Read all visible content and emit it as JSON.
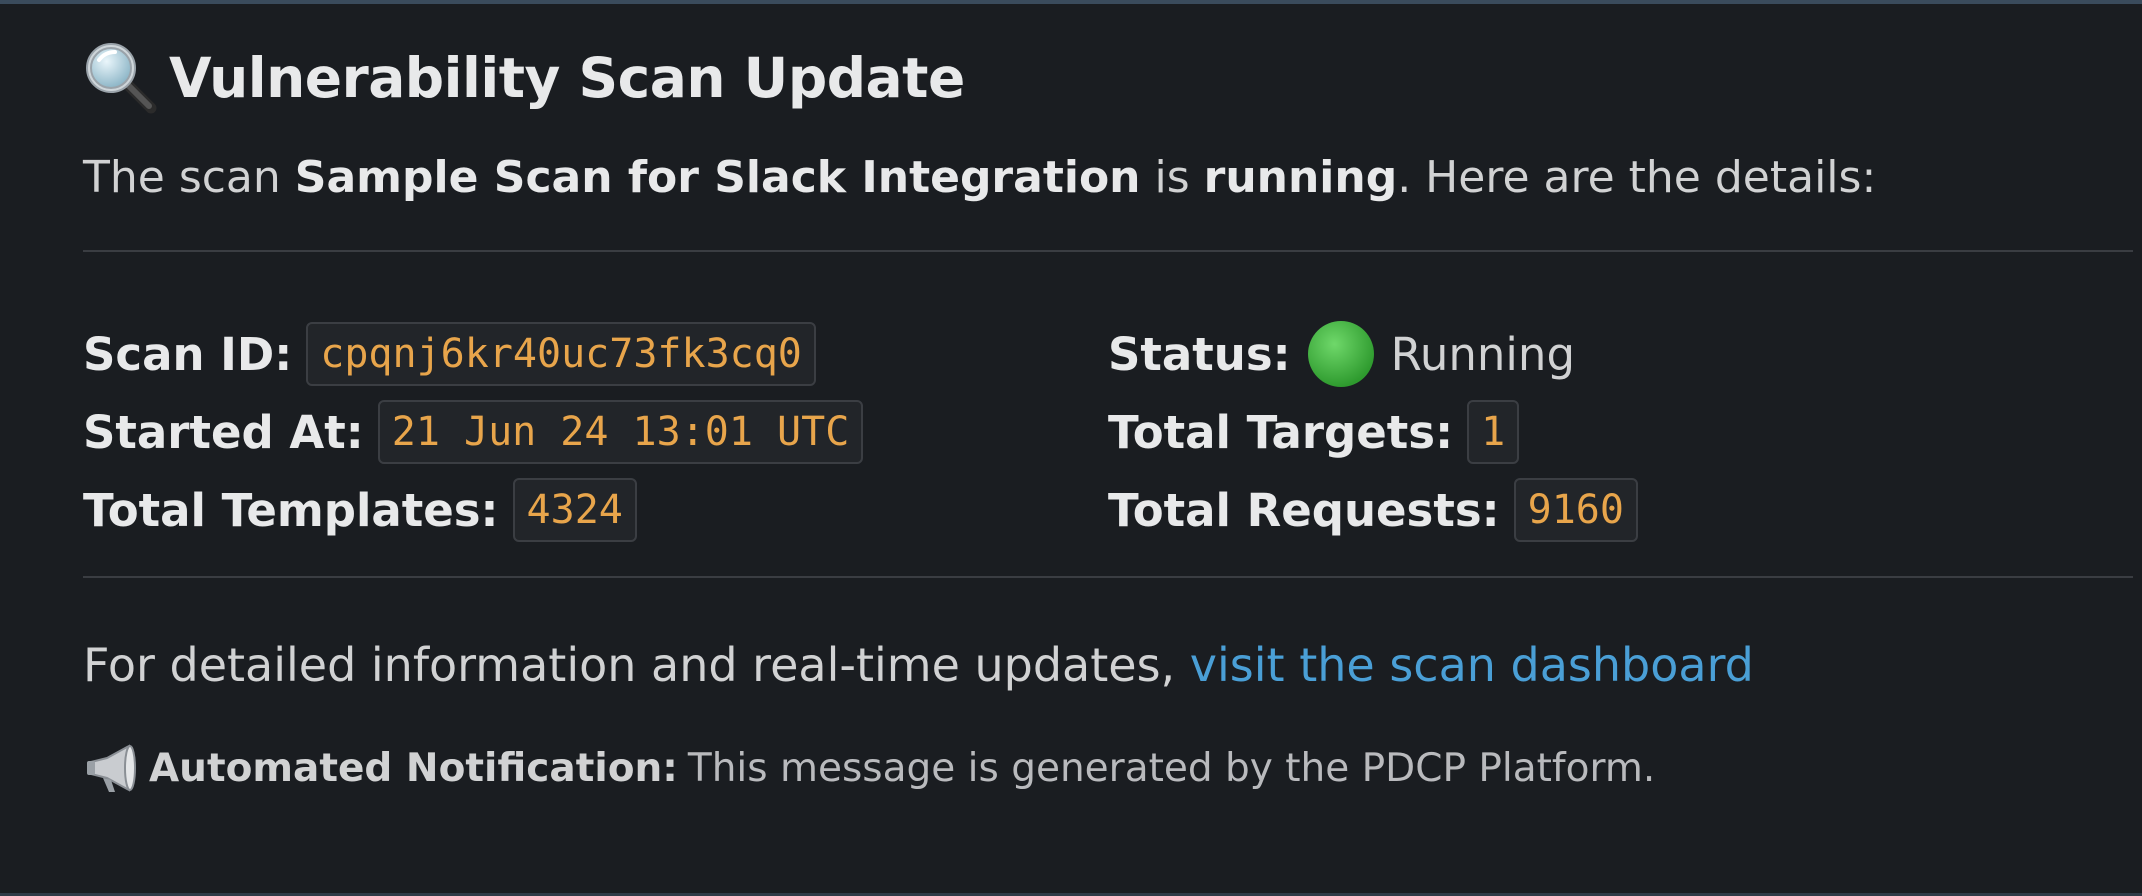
{
  "header": {
    "icon": "magnifying-glass-icon",
    "title": "Vulnerability Scan Update"
  },
  "intro": {
    "prefix": "The scan ",
    "scan_name": "Sample Scan for Slack Integration",
    "middle": " is ",
    "state": "running",
    "suffix": ". Here are the details:"
  },
  "fields": {
    "scan_id": {
      "label": "Scan ID:",
      "value": "cpqnj6kr40uc73fk3cq0"
    },
    "started_at": {
      "label": "Started At:",
      "value": "21 Jun 24 13:01 UTC"
    },
    "total_templates": {
      "label": "Total Templates:",
      "value": "4324"
    },
    "status": {
      "label": "Status:",
      "value": "Running",
      "icon": "green-circle-icon"
    },
    "total_targets": {
      "label": "Total Targets:",
      "value": "1"
    },
    "total_requests": {
      "label": "Total Requests:",
      "value": "9160"
    }
  },
  "footer": {
    "text": "For detailed information and real-time updates, ",
    "link_text": "visit the scan dashboard"
  },
  "notice": {
    "icon": "megaphone-icon",
    "label": "Automated Notification:",
    "text": "This message is generated by the PDCP Platform."
  },
  "colors": {
    "background": "#1a1d21",
    "code_text": "#e8a54b",
    "link": "#4a9fd6",
    "status_green": "#3cb043"
  }
}
